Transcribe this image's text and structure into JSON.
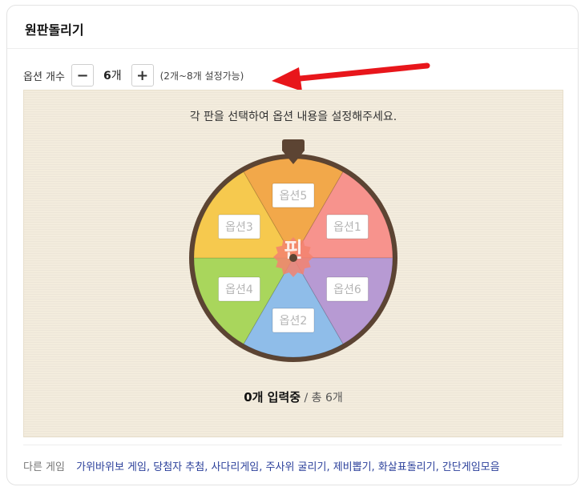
{
  "title": "원판돌리기",
  "options": {
    "label": "옵션 개수",
    "minus_label": "−",
    "plus_label": "+",
    "count_value": "6",
    "count_unit": "개",
    "range_hint": "(2개~8개 설정가능)"
  },
  "board": {
    "hint": "각 판을 선택하여 옵션 내용을 설정해주세요.",
    "center_label": "핀",
    "segments": [
      {
        "label": "옵션5",
        "color": "#f2a84a"
      },
      {
        "label": "옵션1",
        "color": "#f7938d"
      },
      {
        "label": "옵션6",
        "color": "#b79ad3"
      },
      {
        "label": "옵션2",
        "color": "#8fbde9"
      },
      {
        "label": "옵션4",
        "color": "#a9d65c"
      },
      {
        "label": "옵션3",
        "color": "#f6c94e"
      }
    ],
    "status_current": "0개 입력중",
    "status_total": " / 총 6개"
  },
  "footer": {
    "label": "다른 게임",
    "links": [
      "가위바위보 게임",
      "당첨자 추첨",
      "사다리게임",
      "주사위 굴리기",
      "제비뽑기",
      "화살표돌리기",
      "간단게임모음"
    ]
  },
  "colors": {
    "arrow": "#e8161b",
    "wheel_rim": "#5c4433",
    "link": "#2a3f9a"
  }
}
